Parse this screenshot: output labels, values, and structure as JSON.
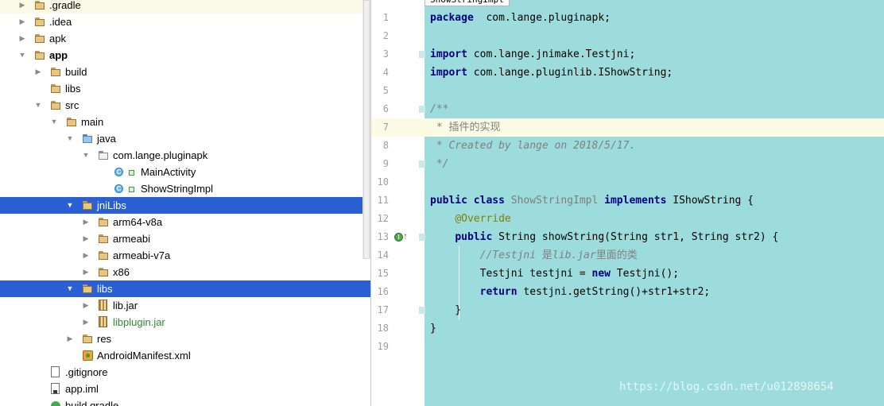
{
  "editor_tab": "ShowStringImpl",
  "tree": [
    {
      "label": ".gradle",
      "indent": 0,
      "arrow": "right",
      "icon": "folder-icon"
    },
    {
      "label": ".idea",
      "indent": 0,
      "arrow": "right",
      "icon": "folder-icon"
    },
    {
      "label": "apk",
      "indent": 0,
      "arrow": "right",
      "icon": "folder-icon"
    },
    {
      "label": "app",
      "indent": 0,
      "arrow": "down",
      "icon": "module-folder-icon"
    },
    {
      "label": "build",
      "indent": 1,
      "arrow": "right",
      "icon": "folder-icon"
    },
    {
      "label": "libs",
      "indent": 1,
      "arrow": "none",
      "icon": "folder-icon"
    },
    {
      "label": "src",
      "indent": 1,
      "arrow": "down",
      "icon": "folder-icon"
    },
    {
      "label": "main",
      "indent": 2,
      "arrow": "down",
      "icon": "folder-icon"
    },
    {
      "label": "java",
      "indent": 3,
      "arrow": "down",
      "icon": "source-folder-icon"
    },
    {
      "label": "com.lange.pluginapk",
      "indent": 4,
      "arrow": "down",
      "icon": "package-icon"
    },
    {
      "label": "MainActivity",
      "indent": 5,
      "arrow": "none",
      "icon": "class-icon"
    },
    {
      "label": "ShowStringImpl",
      "indent": 5,
      "arrow": "none",
      "icon": "class-icon"
    },
    {
      "label": "jniLibs",
      "indent": 3,
      "arrow": "down",
      "icon": "folder-icon"
    },
    {
      "label": "arm64-v8a",
      "indent": 4,
      "arrow": "right",
      "icon": "folder-icon"
    },
    {
      "label": "armeabi",
      "indent": 4,
      "arrow": "right",
      "icon": "folder-icon"
    },
    {
      "label": "armeabi-v7a",
      "indent": 4,
      "arrow": "right",
      "icon": "folder-icon"
    },
    {
      "label": "x86",
      "indent": 4,
      "arrow": "right",
      "icon": "folder-icon"
    },
    {
      "label": "libs",
      "indent": 3,
      "arrow": "down",
      "icon": "folder-icon"
    },
    {
      "label": "lib.jar",
      "indent": 4,
      "arrow": "right",
      "icon": "jar-icon"
    },
    {
      "label": "libplugin.jar",
      "indent": 4,
      "arrow": "right",
      "icon": "jar-icon"
    },
    {
      "label": "res",
      "indent": 3,
      "arrow": "right",
      "icon": "resource-folder-icon"
    },
    {
      "label": "AndroidManifest.xml",
      "indent": 3,
      "arrow": "none",
      "icon": "manifest-icon"
    },
    {
      "label": ".gitignore",
      "indent": 1,
      "arrow": "none",
      "icon": "text-file-icon"
    },
    {
      "label": "app.iml",
      "indent": 1,
      "arrow": "none",
      "icon": "iml-file-icon"
    },
    {
      "label": "build.gradle",
      "indent": 1,
      "arrow": "none",
      "icon": "gradle-icon"
    }
  ],
  "code_lines": [
    {
      "n": "1",
      "parts": [
        [
          "kw",
          "package"
        ],
        [
          "",
          "  com.lange.pluginapk;"
        ]
      ]
    },
    {
      "n": "2",
      "parts": []
    },
    {
      "n": "3",
      "parts": [
        [
          "kw",
          "import"
        ],
        [
          "",
          " com.lange.jnimake.Testjni;"
        ]
      ]
    },
    {
      "n": "4",
      "parts": [
        [
          "kw",
          "import"
        ],
        [
          "",
          " com.lange.pluginlib.IShowString;"
        ]
      ]
    },
    {
      "n": "5",
      "parts": []
    },
    {
      "n": "6",
      "parts": [
        [
          "cm",
          "/**"
        ]
      ]
    },
    {
      "n": "7",
      "parts": [
        [
          "cmn",
          " * 插件的实现"
        ]
      ]
    },
    {
      "n": "8",
      "parts": [
        [
          "cm",
          " * Created by lange on 2018/5/17."
        ]
      ]
    },
    {
      "n": "9",
      "parts": [
        [
          "cm",
          " */"
        ]
      ]
    },
    {
      "n": "10",
      "parts": []
    },
    {
      "n": "11",
      "parts": [
        [
          "kw",
          "public class"
        ],
        [
          "",
          " "
        ],
        [
          "unused",
          "ShowStringImpl"
        ],
        [
          "",
          " "
        ],
        [
          "kw",
          "implements"
        ],
        [
          "",
          " IShowString {"
        ]
      ]
    },
    {
      "n": "12",
      "parts": [
        [
          "",
          "    "
        ],
        [
          "ann",
          "@Override"
        ]
      ]
    },
    {
      "n": "13",
      "parts": [
        [
          "",
          "    "
        ],
        [
          "kw",
          "public"
        ],
        [
          "",
          " String showString(String str1, String str2) {"
        ]
      ]
    },
    {
      "n": "14",
      "parts": [
        [
          "",
          "        "
        ],
        [
          "cm",
          "//Testjni "
        ],
        [
          "cmn",
          "是"
        ],
        [
          "cm",
          "lib.jar"
        ],
        [
          "cmn",
          "里面的类"
        ]
      ]
    },
    {
      "n": "15",
      "parts": [
        [
          "",
          "        Testjni testjni = "
        ],
        [
          "kw",
          "new"
        ],
        [
          "",
          " Testjni();"
        ]
      ]
    },
    {
      "n": "16",
      "parts": [
        [
          "",
          "        "
        ],
        [
          "kw",
          "return"
        ],
        [
          "",
          " testjni.getString()+str1+str2;"
        ]
      ]
    },
    {
      "n": "17",
      "parts": [
        [
          "",
          "    }"
        ]
      ]
    },
    {
      "n": "18",
      "parts": [
        [
          "",
          "}"
        ]
      ]
    },
    {
      "n": "19",
      "parts": []
    }
  ],
  "watermark": "https://blog.csdn.net/u012898654",
  "colors": {
    "editor_background": "#9ddcdc",
    "selection": "#2b60d4",
    "keyword": "#000080",
    "comment": "#808080",
    "annotation": "#808000",
    "caret_line": "#fdfbe3"
  }
}
